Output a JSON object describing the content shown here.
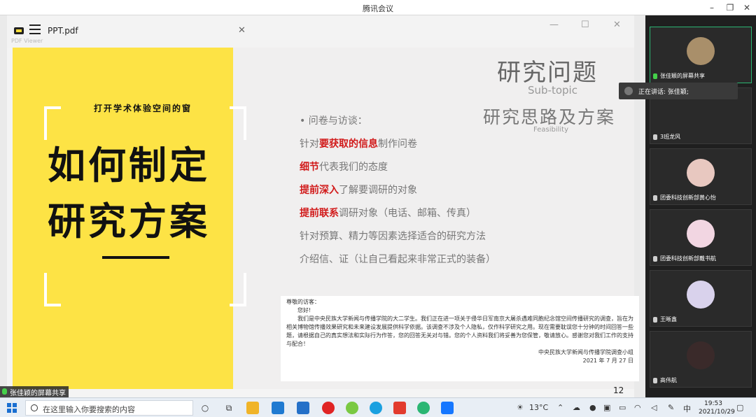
{
  "window": {
    "title": "腾讯会议",
    "min_icon": "minimize-icon",
    "max_icon": "maximize-icon",
    "close_icon": "close-icon"
  },
  "viewer": {
    "filename": "PPT.pdf",
    "brand_small": "PDF Viewer"
  },
  "slide": {
    "tagline": "打开学术体验空间的窗",
    "title_line1": "如何制定",
    "title_line2": "研究方案",
    "right_title1": "研究问题",
    "right_sub1": "Sub-topic",
    "right_title2": "研究思路及方案",
    "right_sub2": "Feasibility",
    "bullets": [
      {
        "pre": "• 问卷与访谈：",
        "hl": "",
        "post": ""
      },
      {
        "pre": "针对",
        "hl": "要获取的信息",
        "post": "制作问卷"
      },
      {
        "pre": "",
        "hl": "细节",
        "post": "代表我们的态度"
      },
      {
        "pre": "",
        "hl": "提前深入",
        "post": "了解要调研的对象"
      },
      {
        "pre": "",
        "hl": "提前联系",
        "post": "调研对象（电话、邮箱、传真）"
      },
      {
        "pre": "针对预算、精力等因素选择适合的研究方法",
        "hl": "",
        "post": ""
      },
      {
        "pre": "介绍信、证（让自己看起来非常正式的装备）",
        "hl": "",
        "post": ""
      }
    ],
    "letter": {
      "greeting": "尊敬的访客：",
      "hello": "您好!",
      "body": "我们是中央民族大学新闻与传播学院的大二学生。我们正在进一项关于侵华日军南京大屠杀遇难同胞纪念馆空间传播研究的调查，旨在为相关博物馆传播效果研究和未来建设发展提供科学依据。该调查不涉及个人隐私，仅作科学研究之用。现在需要耽误您十分钟的时间回答一些题，请根据自己的真实想法和实际行为作答，您的回答无关对与错。您的个人资料我们将妥善为您保管，敬请放心。感谢您对我们工作的支持与配合！",
      "sign": "中央民族大学新闻与传播学院调查小组",
      "date": "2021 年 7 月 27 日"
    },
    "page_number": "12"
  },
  "share_label": "张佳颖的屏幕共享",
  "speaking_label": "正在讲话: 张佳颖;",
  "participants": [
    {
      "name": "张佳颖的屏幕共享",
      "avatar_color": "#a98f6a",
      "active": true
    },
    {
      "name": "3班龙风",
      "avatar_color": "",
      "active": false
    },
    {
      "name": "团委科技创新部黄心怡",
      "avatar_color": "#e8c8c0",
      "active": false
    },
    {
      "name": "团委科技创新部戴书航",
      "avatar_color": "#f2d6e2",
      "active": false
    },
    {
      "name": "王晰鑫",
      "avatar_color": "#d9d2ec",
      "active": false
    },
    {
      "name": "高伟航",
      "avatar_color": "#3a2a2a",
      "active": false
    }
  ],
  "taskbar": {
    "search_placeholder": "在这里输入你要搜索的内容",
    "weather": "13°C",
    "ime": "中",
    "time": "19:53",
    "date": "2021/10/29"
  }
}
